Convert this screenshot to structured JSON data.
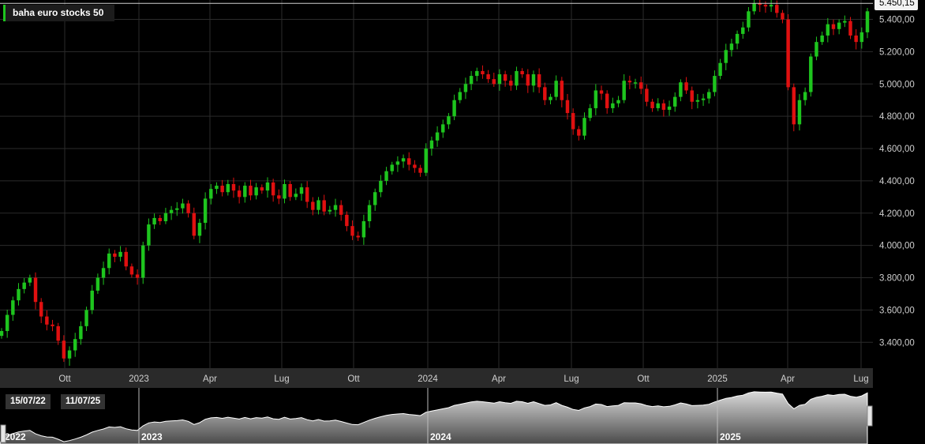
{
  "instrument": {
    "name": "baha euro stocks 50",
    "last_price_label": "5.450,15"
  },
  "colors": {
    "up": "#1ec51e",
    "down": "#e01010",
    "grid": "#2b2b2b",
    "background": "#000000"
  },
  "navigator": {
    "start_date": "15/07/22",
    "end_date": "11/07/25",
    "year_labels": [
      "2022",
      "2023",
      "2024",
      "2025"
    ]
  },
  "chart_data": {
    "type": "candlestick",
    "title": "baha euro stocks 50",
    "ylim": [
      3240,
      5520
    ],
    "y_ticks": [
      "3.400,00",
      "3.600,00",
      "3.800,00",
      "4.000,00",
      "4.200,00",
      "4.400,00",
      "4.600,00",
      "4.800,00",
      "5.000,00",
      "5.200,00",
      "5.400,00"
    ],
    "x_ticks": [
      "Ott",
      "2023",
      "Apr",
      "Lug",
      "Ott",
      "2024",
      "Apr",
      "Lug",
      "Ott",
      "2025",
      "Apr",
      "Lug"
    ],
    "last_value": 5450.15,
    "grid": true,
    "weekly_close": [
      3470,
      3570,
      3660,
      3730,
      3770,
      3800,
      3650,
      3560,
      3510,
      3500,
      3410,
      3300,
      3350,
      3420,
      3500,
      3600,
      3720,
      3800,
      3860,
      3950,
      3930,
      3960,
      3870,
      3820,
      3800,
      4000,
      4130,
      4170,
      4150,
      4200,
      4220,
      4230,
      4260,
      4200,
      4060,
      4140,
      4290,
      4350,
      4370,
      4330,
      4380,
      4340,
      4300,
      4370,
      4310,
      4360,
      4340,
      4390,
      4310,
      4290,
      4380,
      4300,
      4320,
      4360,
      4270,
      4220,
      4280,
      4210,
      4220,
      4250,
      4190,
      4120,
      4060,
      4050,
      4150,
      4250,
      4330,
      4400,
      4460,
      4500,
      4520,
      4540,
      4500,
      4480,
      4450,
      4600,
      4650,
      4700,
      4750,
      4800,
      4900,
      4950,
      5000,
      5050,
      5080,
      5060,
      5030,
      5000,
      5060,
      5020,
      4990,
      5080,
      5060,
      4990,
      5060,
      4980,
      4900,
      4920,
      5020,
      4900,
      4820,
      4720,
      4680,
      4790,
      4850,
      4960,
      4940,
      4850,
      4880,
      4900,
      5020,
      5010,
      5010,
      4970,
      4890,
      4850,
      4880,
      4840,
      4860,
      4920,
      5010,
      4960,
      4890,
      4900,
      4910,
      4950,
      5050,
      5130,
      5210,
      5250,
      5310,
      5350,
      5450,
      5500,
      5490,
      5480,
      5490,
      5440,
      5400,
      4980,
      4750,
      4900,
      4950,
      5170,
      5260,
      5300,
      5370,
      5340,
      5380,
      5390,
      5300,
      5260,
      5320,
      5450
    ]
  }
}
